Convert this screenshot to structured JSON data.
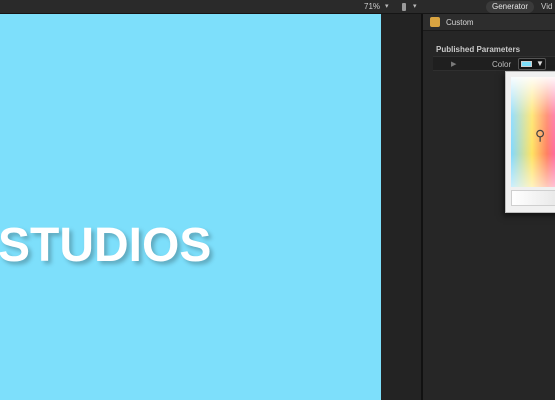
{
  "topbar": {
    "zoom_value": "71%",
    "zoom_chevron": "▾",
    "view_chevron": "▾",
    "tabs": [
      {
        "label": "Generator"
      },
      {
        "label": "Vid"
      }
    ]
  },
  "canvas": {
    "title_text": "STUDIOS",
    "background_color": "#7ddffb"
  },
  "inspector": {
    "header_title": "Custom",
    "section_title": "Published Parameters",
    "param": {
      "disclosure": "▶",
      "label": "Color",
      "swatch_color": "#7ddffb",
      "chevron": "▼"
    }
  },
  "icons": {
    "dropper": "eyedropper-icon",
    "inspector": "generator-icon"
  }
}
